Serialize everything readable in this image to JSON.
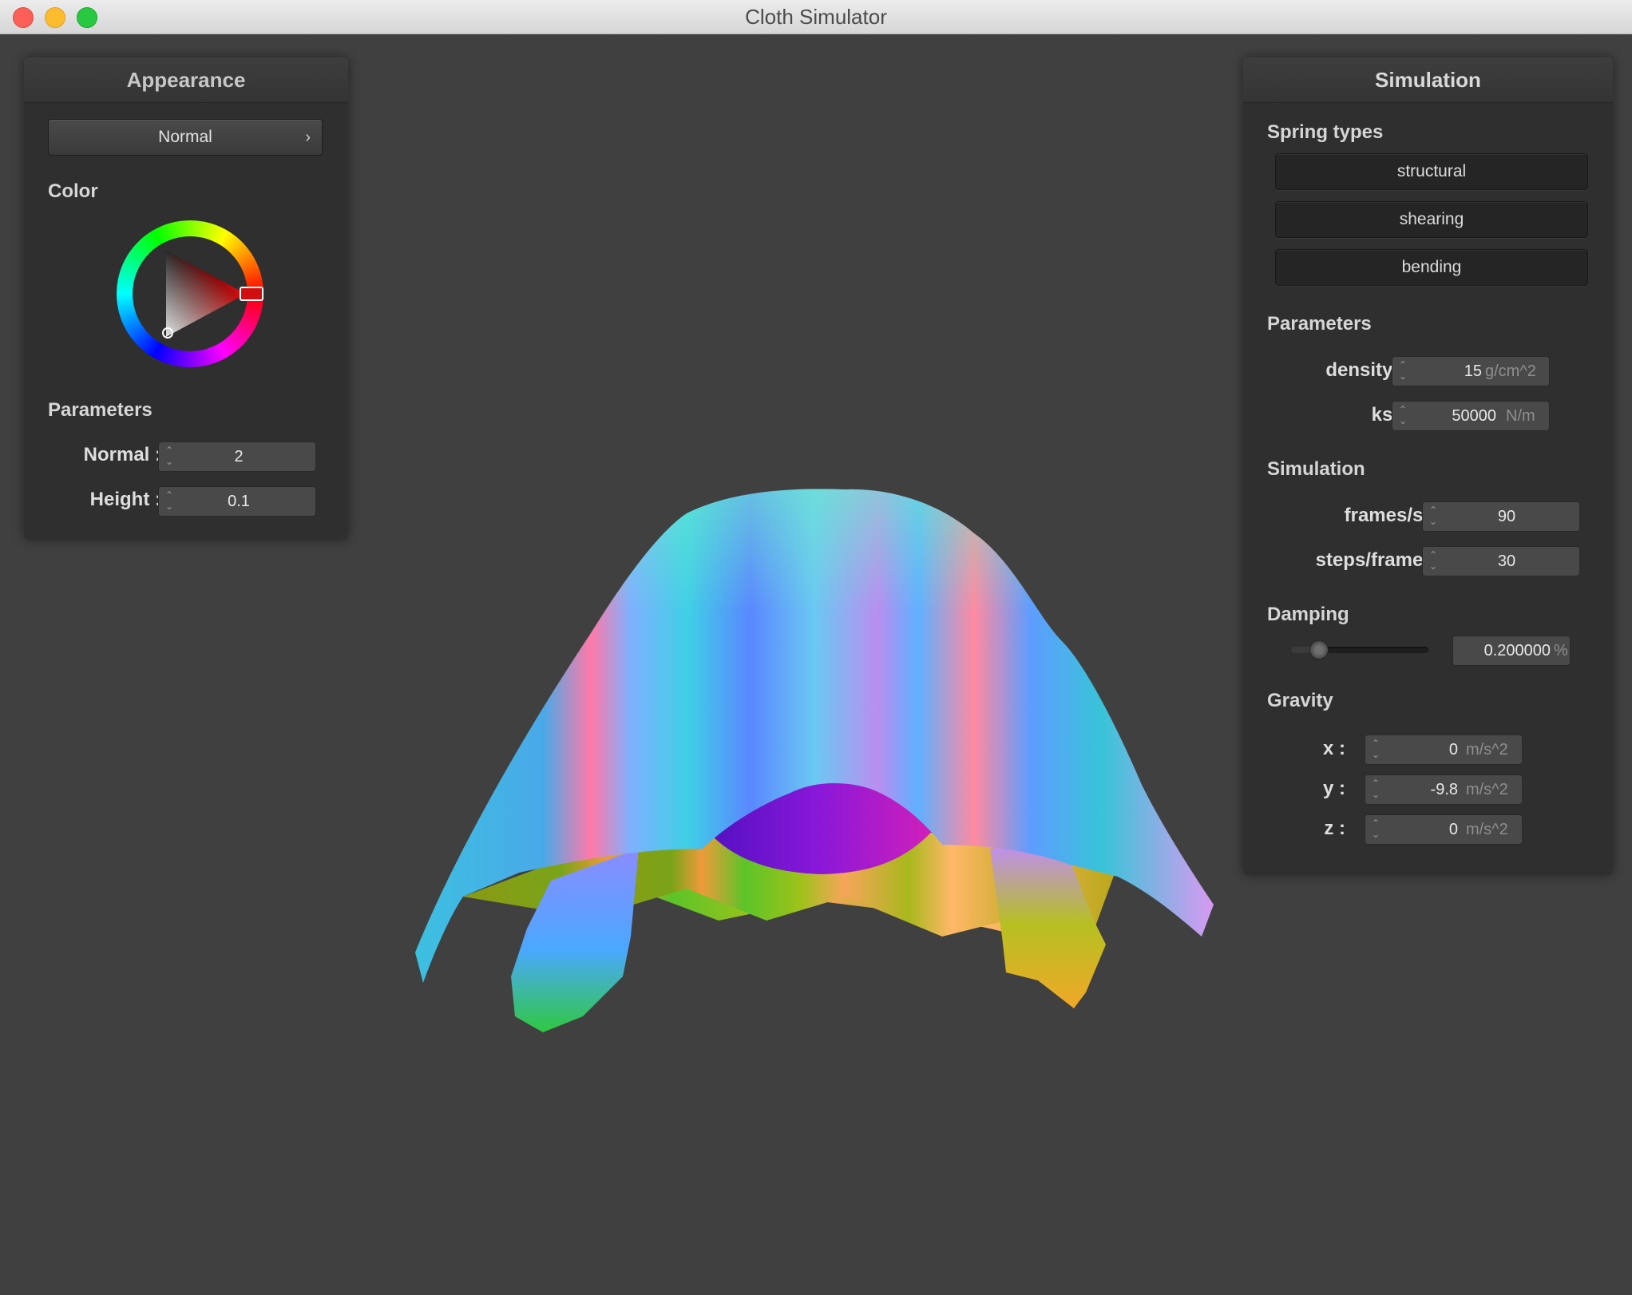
{
  "window": {
    "title": "Cloth Simulator"
  },
  "appearance": {
    "header": "Appearance",
    "shader_dropdown": "Normal",
    "color_section": "Color",
    "color": "#cc1111",
    "parameters_section": "Parameters",
    "normal": {
      "label": "Normal :",
      "value": "2"
    },
    "height": {
      "label": "Height :",
      "value": "0.1"
    }
  },
  "simulation": {
    "header": "Simulation",
    "spring_types_section": "Spring types",
    "buttons": {
      "structural": "structural",
      "shearing": "shearing",
      "bending": "bending"
    },
    "parameters_section": "Parameters",
    "density": {
      "label": "density :",
      "value": "15",
      "unit": "g/cm^2"
    },
    "ks": {
      "label": "ks :",
      "value": "50000",
      "unit": "N/m"
    },
    "simulation_section": "Simulation",
    "frames": {
      "label": "frames/s :",
      "value": "90"
    },
    "steps": {
      "label": "steps/frame :",
      "value": "30"
    },
    "damping_section": "Damping",
    "damping": {
      "value": "0.200000",
      "unit": "%",
      "fraction": 0.2
    },
    "gravity_section": "Gravity",
    "gravity": {
      "x": {
        "label": "x :",
        "value": "0",
        "unit": "m/s^2"
      },
      "y": {
        "label": "y :",
        "value": "-9.8",
        "unit": "m/s^2"
      },
      "z": {
        "label": "z :",
        "value": "0",
        "unit": "m/s^2"
      }
    }
  }
}
